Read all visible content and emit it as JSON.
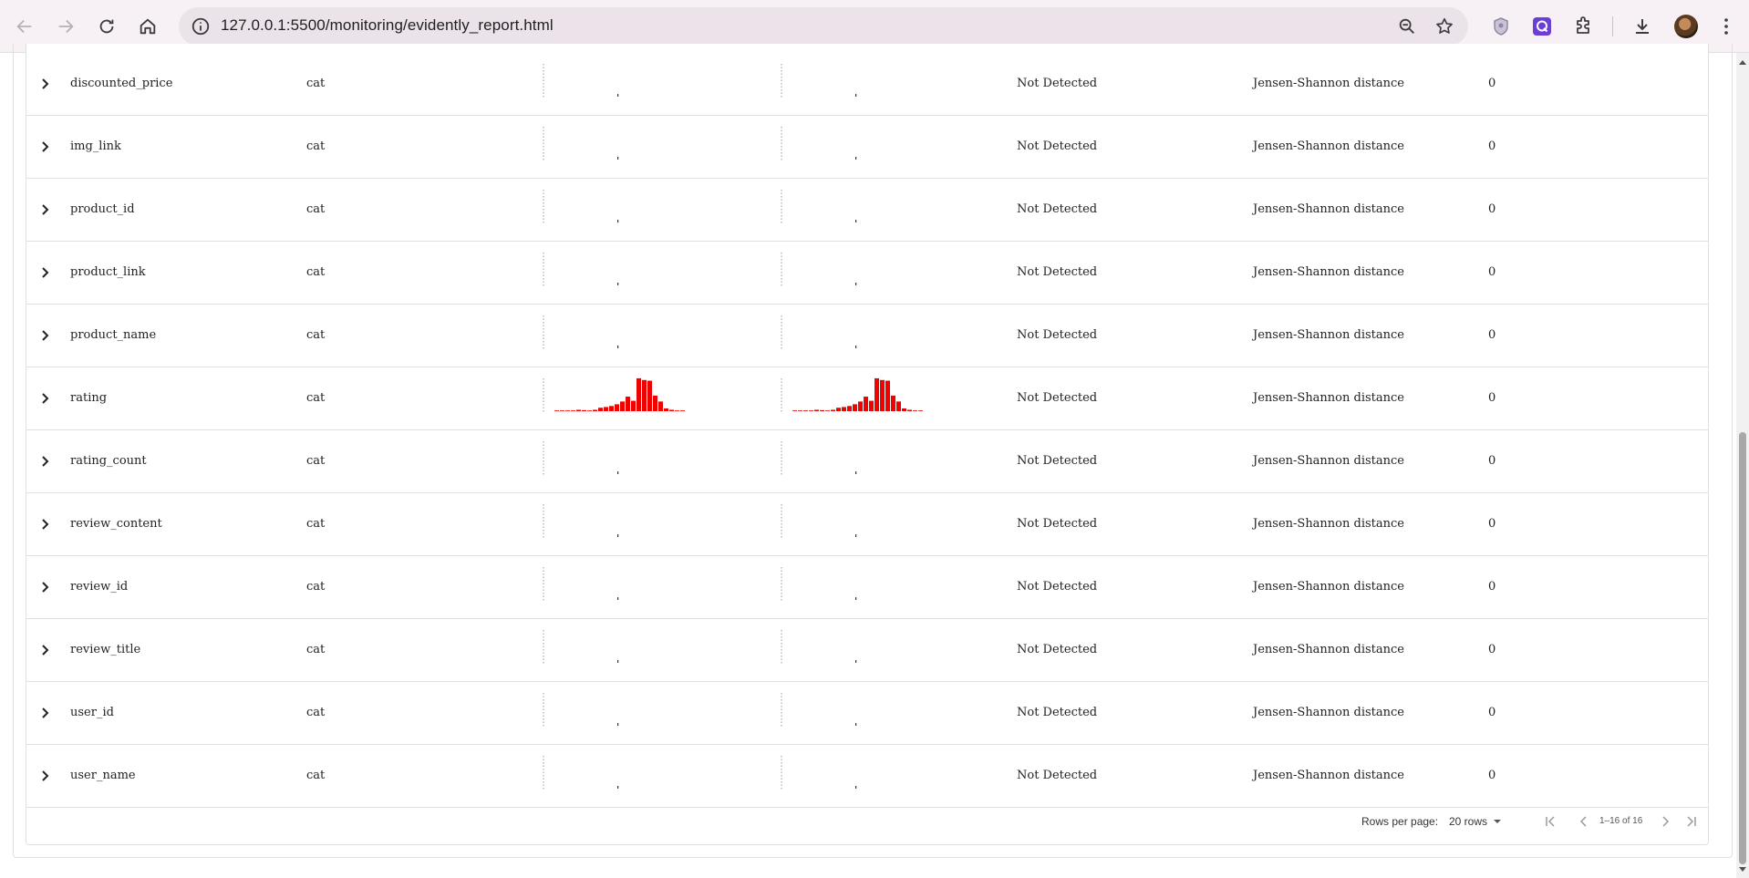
{
  "browser": {
    "url": "127.0.0.1:5500/monitoring/evidently_report.html"
  },
  "table": {
    "rows": [
      {
        "column": "discounted_price",
        "type": "cat",
        "drift": "Not Detected",
        "stattest": "Jensen-Shannon distance",
        "score": "0",
        "hist": "flat"
      },
      {
        "column": "img_link",
        "type": "cat",
        "drift": "Not Detected",
        "stattest": "Jensen-Shannon distance",
        "score": "0",
        "hist": "flat"
      },
      {
        "column": "product_id",
        "type": "cat",
        "drift": "Not Detected",
        "stattest": "Jensen-Shannon distance",
        "score": "0",
        "hist": "flat"
      },
      {
        "column": "product_link",
        "type": "cat",
        "drift": "Not Detected",
        "stattest": "Jensen-Shannon distance",
        "score": "0",
        "hist": "flat"
      },
      {
        "column": "product_name",
        "type": "cat",
        "drift": "Not Detected",
        "stattest": "Jensen-Shannon distance",
        "score": "0",
        "hist": "flat"
      },
      {
        "column": "rating",
        "type": "cat",
        "drift": "Not Detected",
        "stattest": "Jensen-Shannon distance",
        "score": "0",
        "hist": "rating"
      },
      {
        "column": "rating_count",
        "type": "cat",
        "drift": "Not Detected",
        "stattest": "Jensen-Shannon distance",
        "score": "0",
        "hist": "flat"
      },
      {
        "column": "review_content",
        "type": "cat",
        "drift": "Not Detected",
        "stattest": "Jensen-Shannon distance",
        "score": "0",
        "hist": "flat"
      },
      {
        "column": "review_id",
        "type": "cat",
        "drift": "Not Detected",
        "stattest": "Jensen-Shannon distance",
        "score": "0",
        "hist": "flat"
      },
      {
        "column": "review_title",
        "type": "cat",
        "drift": "Not Detected",
        "stattest": "Jensen-Shannon distance",
        "score": "0",
        "hist": "flat"
      },
      {
        "column": "user_id",
        "type": "cat",
        "drift": "Not Detected",
        "stattest": "Jensen-Shannon distance",
        "score": "0",
        "hist": "flat"
      },
      {
        "column": "user_name",
        "type": "cat",
        "drift": "Not Detected",
        "stattest": "Jensen-Shannon distance",
        "score": "0",
        "hist": "flat"
      }
    ],
    "rating_histogram": [
      0.02,
      0.02,
      0.02,
      0.02,
      0.04,
      0.03,
      0.02,
      0.04,
      0.1,
      0.12,
      0.15,
      0.2,
      0.28,
      0.42,
      0.3,
      0.95,
      0.9,
      0.88,
      0.45,
      0.28,
      0.08,
      0.04,
      0.02,
      0.02
    ]
  },
  "footer": {
    "rows_per_page_label": "Rows per page:",
    "rows_per_page_value": "20 rows",
    "range_text": "1–16 of 16"
  },
  "colors": {
    "histogram_bar": "#ed0400",
    "accent_icon": "#6b3fd6"
  }
}
